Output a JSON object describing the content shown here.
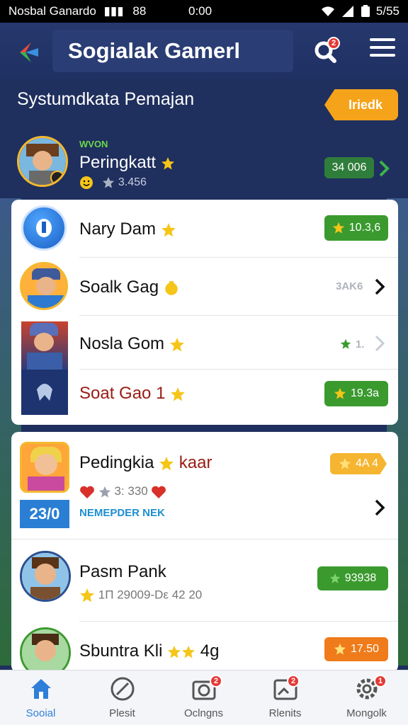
{
  "status_bar": {
    "carrier": "Nosbal Ganardo",
    "signal_text": "88",
    "time": "0:00",
    "battery": "5/55"
  },
  "app_bar": {
    "title": "Sogialak Gamerl",
    "search_badge": "2"
  },
  "section": {
    "title": "Systumdkata Pemajan",
    "cta_label": "Iriedk"
  },
  "my_rank": {
    "tag": "WVON",
    "name": "Peringkatt",
    "sub_value": "3.456",
    "score": "34 006"
  },
  "list1": [
    {
      "name": "Nary Dam",
      "score": "10.3,6"
    },
    {
      "name": "Soalk Gag",
      "right_text": "3AK6"
    },
    {
      "name": "Nosla Gom",
      "right_text": "1."
    },
    {
      "name": "Soat Gao 1",
      "score": "19.3a"
    }
  ],
  "list2": [
    {
      "name": "Pedingkia",
      "name_suffix": "kaar",
      "score": "4A 4",
      "sub_value": "3: 330",
      "tag": "NEMEPDER NEK",
      "badge": "23/0"
    },
    {
      "name": "Pasm Pank",
      "sub_value": "1Π 29009-Dε 42 20",
      "score": "93938"
    },
    {
      "name": "Sbuntra Kli",
      "name_suffix": "4g",
      "score": "17.50"
    }
  ],
  "bottom_nav": [
    {
      "label": "Sooial",
      "active": true
    },
    {
      "label": "Plesit",
      "active": false
    },
    {
      "label": "Oclngns",
      "active": false,
      "badge": "2"
    },
    {
      "label": "Rlenits",
      "active": false,
      "badge": "2"
    },
    {
      "label": "Mongolk",
      "active": false,
      "badge": "1"
    }
  ],
  "colors": {
    "bg": "#1f2f5e",
    "accent_orange": "#f5a31a",
    "score_green": "#2f8d3a",
    "score_orange": "#ef7b1a",
    "active_nav": "#2f7fd8",
    "badge_red": "#e53935"
  }
}
